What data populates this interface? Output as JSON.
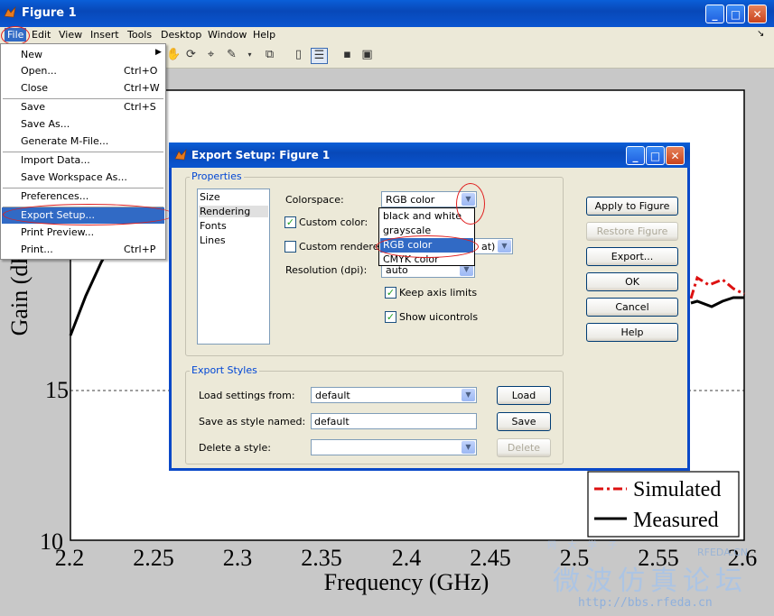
{
  "window": {
    "title": "Figure 1",
    "minimize": "_",
    "maximize": "□",
    "close": "✕"
  },
  "menubar": [
    "File",
    "Edit",
    "View",
    "Insert",
    "Tools",
    "Desktop",
    "Window",
    "Help"
  ],
  "toolbar_icons": [
    "hand-icon",
    "rotate-icon",
    "data-cursor-icon",
    "brush-icon",
    "link-icon",
    "colorbar-icon",
    "legend-icon",
    "hide-icon",
    "show-icon"
  ],
  "file_menu": [
    {
      "label": "New",
      "shortcut": "",
      "submenu": true
    },
    {
      "label": "Open...",
      "shortcut": "Ctrl+O"
    },
    {
      "label": "Close",
      "shortcut": "Ctrl+W"
    },
    {
      "label": "Save",
      "shortcut": "Ctrl+S"
    },
    {
      "label": "Save As...",
      "shortcut": ""
    },
    {
      "label": "Generate M-File...",
      "shortcut": ""
    },
    {
      "label": "Import Data...",
      "shortcut": ""
    },
    {
      "label": "Save Workspace As...",
      "shortcut": ""
    },
    {
      "label": "Preferences...",
      "shortcut": ""
    },
    {
      "label": "Export Setup...",
      "shortcut": "",
      "selected": true
    },
    {
      "label": "Print Preview...",
      "shortcut": ""
    },
    {
      "label": "Print...",
      "shortcut": "Ctrl+P"
    }
  ],
  "dialog": {
    "title": "Export Setup: Figure 1",
    "properties_legend": "Properties",
    "categories": [
      "Size",
      "Rendering",
      "Fonts",
      "Lines"
    ],
    "colorspace_label": "Colorspace:",
    "colorspace_value": "RGB color",
    "colorspace_options": [
      "black and white",
      "grayscale",
      "RGB color",
      "CMYK color"
    ],
    "custom_color_label": "Custom color:",
    "custom_renderer_label": "Custom renderer:",
    "renderer_partial": "at)",
    "resolution_label": "Resolution (dpi):",
    "resolution_value": "auto",
    "keep_axis_label": "Keep axis limits",
    "show_uicontrols_label": "Show uicontrols",
    "check_mark": "✓",
    "export_styles_legend": "Export Styles",
    "load_settings_label": "Load settings from:",
    "load_settings_value": "default",
    "save_style_label": "Save as style named:",
    "save_style_value": "default",
    "delete_style_label": "Delete a style:",
    "load_btn": "Load",
    "save_btn": "Save",
    "delete_btn": "Delete",
    "apply_btn": "Apply to Figure",
    "restore_btn": "Restore Figure",
    "export_btn": "Export...",
    "ok_btn": "OK",
    "cancel_btn": "Cancel",
    "help_btn": "Help"
  },
  "plot": {
    "ylabel": "Gain (dB)",
    "xlabel": "Frequency (GHz)",
    "y_ticks": [
      "15",
      "10"
    ],
    "x_ticks": [
      "2.2",
      "2.25",
      "2.3",
      "2.35",
      "2.4",
      "2.45",
      "2.5",
      "2.55",
      "2.6"
    ],
    "legend": [
      "Simulated",
      "Measured"
    ],
    "simulated_color": "#dd1111",
    "measured_color": "#000000"
  },
  "watermark": {
    "line1": "微波仿真论坛",
    "url": "http://bbs.rfeda.cn",
    "small": "RFEDA.CN"
  }
}
